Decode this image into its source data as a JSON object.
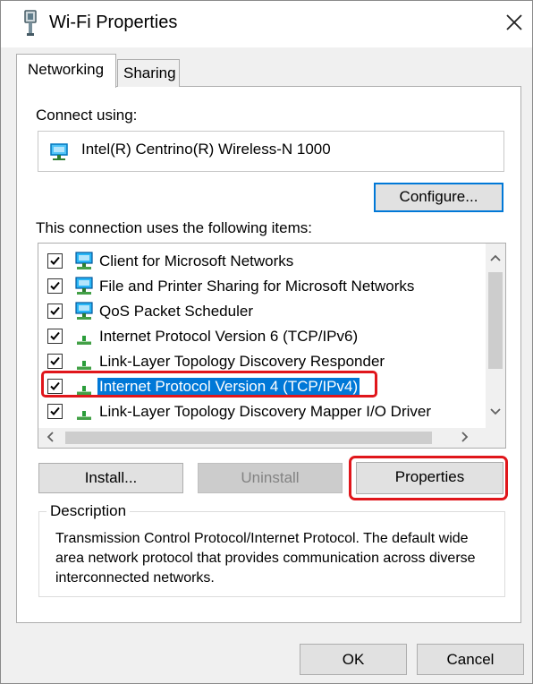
{
  "window": {
    "title": "Wi-Fi Properties"
  },
  "tabs": [
    {
      "label": "Networking",
      "active": true
    },
    {
      "label": "Sharing",
      "active": false
    }
  ],
  "connect_using": {
    "label": "Connect using:",
    "adapter": "Intel(R) Centrino(R) Wireless-N 1000",
    "configure_label": "Configure..."
  },
  "items_section": {
    "label": "This connection uses the following items:",
    "items": [
      {
        "label": "Client for Microsoft Networks",
        "checked": true,
        "icon": "network-client-icon",
        "selected": false
      },
      {
        "label": "File and Printer Sharing for Microsoft Networks",
        "checked": true,
        "icon": "network-service-icon",
        "selected": false
      },
      {
        "label": "QoS Packet Scheduler",
        "checked": true,
        "icon": "network-service-icon",
        "selected": false
      },
      {
        "label": "Internet Protocol Version 6 (TCP/IPv6)",
        "checked": true,
        "icon": "protocol-icon",
        "selected": false
      },
      {
        "label": "Link-Layer Topology Discovery Responder",
        "checked": true,
        "icon": "protocol-icon",
        "selected": false
      },
      {
        "label": "Internet Protocol Version 4 (TCP/IPv4)",
        "checked": true,
        "icon": "protocol-icon",
        "selected": true
      },
      {
        "label": "Link-Layer Topology Discovery Mapper I/O Driver",
        "checked": true,
        "icon": "protocol-icon",
        "selected": false
      }
    ]
  },
  "buttons": {
    "install": "Install...",
    "uninstall": "Uninstall",
    "properties": "Properties",
    "ok": "OK",
    "cancel": "Cancel"
  },
  "description": {
    "title": "Description",
    "text": "Transmission Control Protocol/Internet Protocol. The default wide area network protocol that provides communication across diverse interconnected networks."
  },
  "colors": {
    "selection": "#0078d7",
    "highlight_annotation": "#e0161b",
    "protocol_icon_green": "#2a9d3a"
  }
}
